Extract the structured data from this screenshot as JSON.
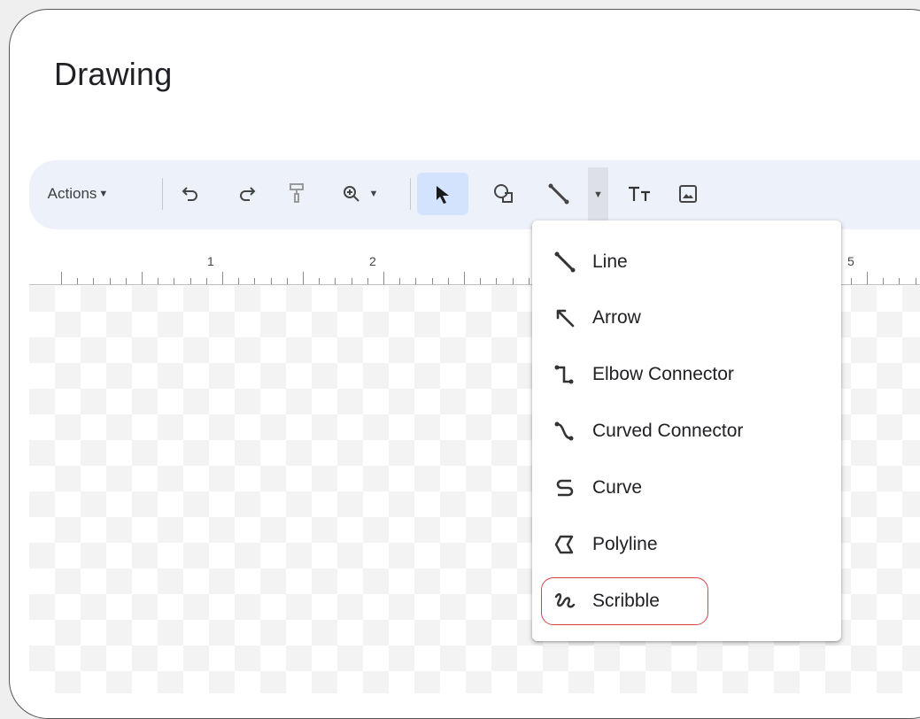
{
  "window": {
    "title": "Drawing"
  },
  "toolbar": {
    "actions_label": "Actions",
    "buttons": [
      {
        "name": "undo-icon"
      },
      {
        "name": "redo-icon"
      },
      {
        "name": "paint-format-icon"
      },
      {
        "name": "zoom-icon"
      },
      {
        "name": "select-icon"
      },
      {
        "name": "shape-icon"
      },
      {
        "name": "line-icon"
      },
      {
        "name": "text-box-icon"
      },
      {
        "name": "image-icon"
      }
    ]
  },
  "ruler": {
    "labels": [
      "1",
      "2",
      "5"
    ]
  },
  "line_menu": {
    "items": [
      {
        "label": "Line",
        "icon": "line-icon"
      },
      {
        "label": "Arrow",
        "icon": "arrow-icon"
      },
      {
        "label": "Elbow Connector",
        "icon": "elbow-connector-icon"
      },
      {
        "label": "Curved Connector",
        "icon": "curved-connector-icon"
      },
      {
        "label": "Curve",
        "icon": "curve-icon"
      },
      {
        "label": "Polyline",
        "icon": "polyline-icon"
      },
      {
        "label": "Scribble",
        "icon": "scribble-icon"
      }
    ],
    "highlighted": "Scribble"
  },
  "colors": {
    "accent": "#d3e3fd",
    "toolbar_bg": "#edf2fa",
    "highlight": "#d84343"
  }
}
